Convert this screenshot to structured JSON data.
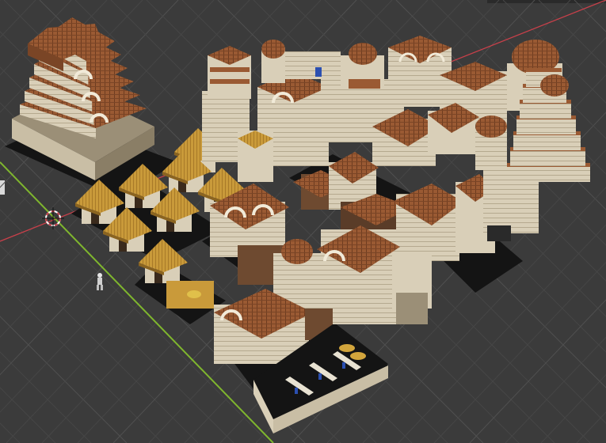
{
  "app": {
    "name": "3D viewport",
    "view": "perspective"
  },
  "scene": {
    "description_note": "",
    "objects": [
      {
        "name": "stepped-temple-left"
      },
      {
        "name": "thatched-huts-group"
      },
      {
        "name": "twin-tower-palace"
      },
      {
        "name": "domed-palace-complex"
      },
      {
        "name": "stepped-temple-right"
      },
      {
        "name": "central-gatehouse"
      },
      {
        "name": "market-hall"
      },
      {
        "name": "walled-courtyard"
      },
      {
        "name": "human-scale-figure"
      }
    ]
  },
  "colors": {
    "background": "#3b3b3b",
    "grid_minor": "#474747",
    "grid_major": "#505050",
    "x_axis": "#c8404a",
    "y_axis": "#7fb62e",
    "roof": "#9a5a33",
    "roof_dark": "#6e3c20",
    "wall": "#d9cfb8",
    "wall_shadow": "#9b8f77",
    "thatch": "#c99a3a",
    "thatch_dark": "#8b6420",
    "ground_base": "#141414"
  }
}
